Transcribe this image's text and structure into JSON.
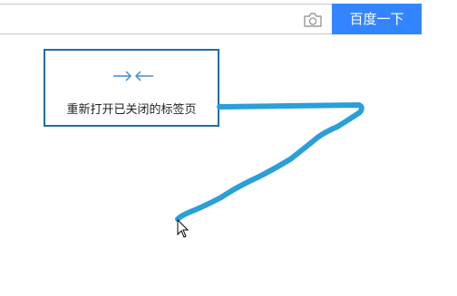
{
  "search": {
    "value": "",
    "button_label": "百度一下"
  },
  "icons": {
    "camera": "camera-icon",
    "gesture_arrows": "arrows-converge-icon",
    "cursor": "mouse-cursor-icon"
  },
  "gesture_tip": {
    "label": "重新打开已关闭的标签页"
  },
  "colors": {
    "search_button": "#3385ff",
    "gesture_stroke": "#2a9fd8",
    "tip_border": "#1e6fa0",
    "arrow_icon": "#3a8fd0"
  }
}
